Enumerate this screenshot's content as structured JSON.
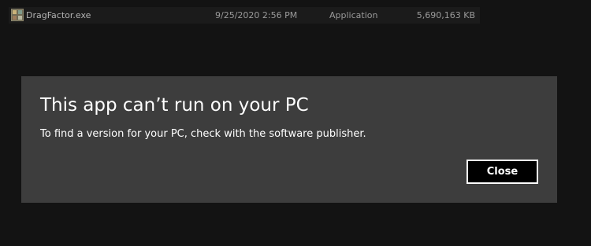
{
  "file_row": {
    "icon": "application-exe-icon",
    "name": "DragFactor.exe",
    "date_modified": "9/25/2020 2:56 PM",
    "type": "Application",
    "size": "5,690,163 KB"
  },
  "dialog": {
    "title": "This app can’t run on your PC",
    "message": "To find a version for your PC, check with the software publisher.",
    "close_label": "Close"
  },
  "colors": {
    "page_background": "#131313",
    "row_background": "#1b1b1b",
    "dialog_background": "#3d3d3d",
    "button_background": "#000000",
    "text_primary": "#ffffff",
    "text_muted": "#9a9a9a"
  }
}
